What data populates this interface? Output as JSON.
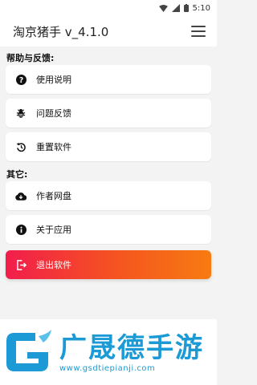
{
  "status_bar": {
    "time": "5:10"
  },
  "app_bar": {
    "title": "淘京猪手 v_4.1.0"
  },
  "sections": {
    "help": {
      "title": "帮助与反馈:",
      "items": [
        {
          "label": "使用说明",
          "icon": "question-icon"
        },
        {
          "label": "问题反馈",
          "icon": "bug-icon"
        },
        {
          "label": "重置软件",
          "icon": "reset-icon"
        }
      ]
    },
    "other": {
      "title": "其它:",
      "items": [
        {
          "label": "作者网盘",
          "icon": "cloud-download-icon"
        },
        {
          "label": "关于应用",
          "icon": "info-icon"
        }
      ]
    }
  },
  "exit": {
    "label": "退出软件",
    "icon": "exit-icon"
  },
  "watermark": {
    "brand": "广晟德手游",
    "url": "www.gsdtiepianji.com"
  },
  "colors": {
    "exit_gradient_start": "#f21d4c",
    "exit_gradient_end": "#f77b11",
    "watermark": "#1b9ad6"
  }
}
